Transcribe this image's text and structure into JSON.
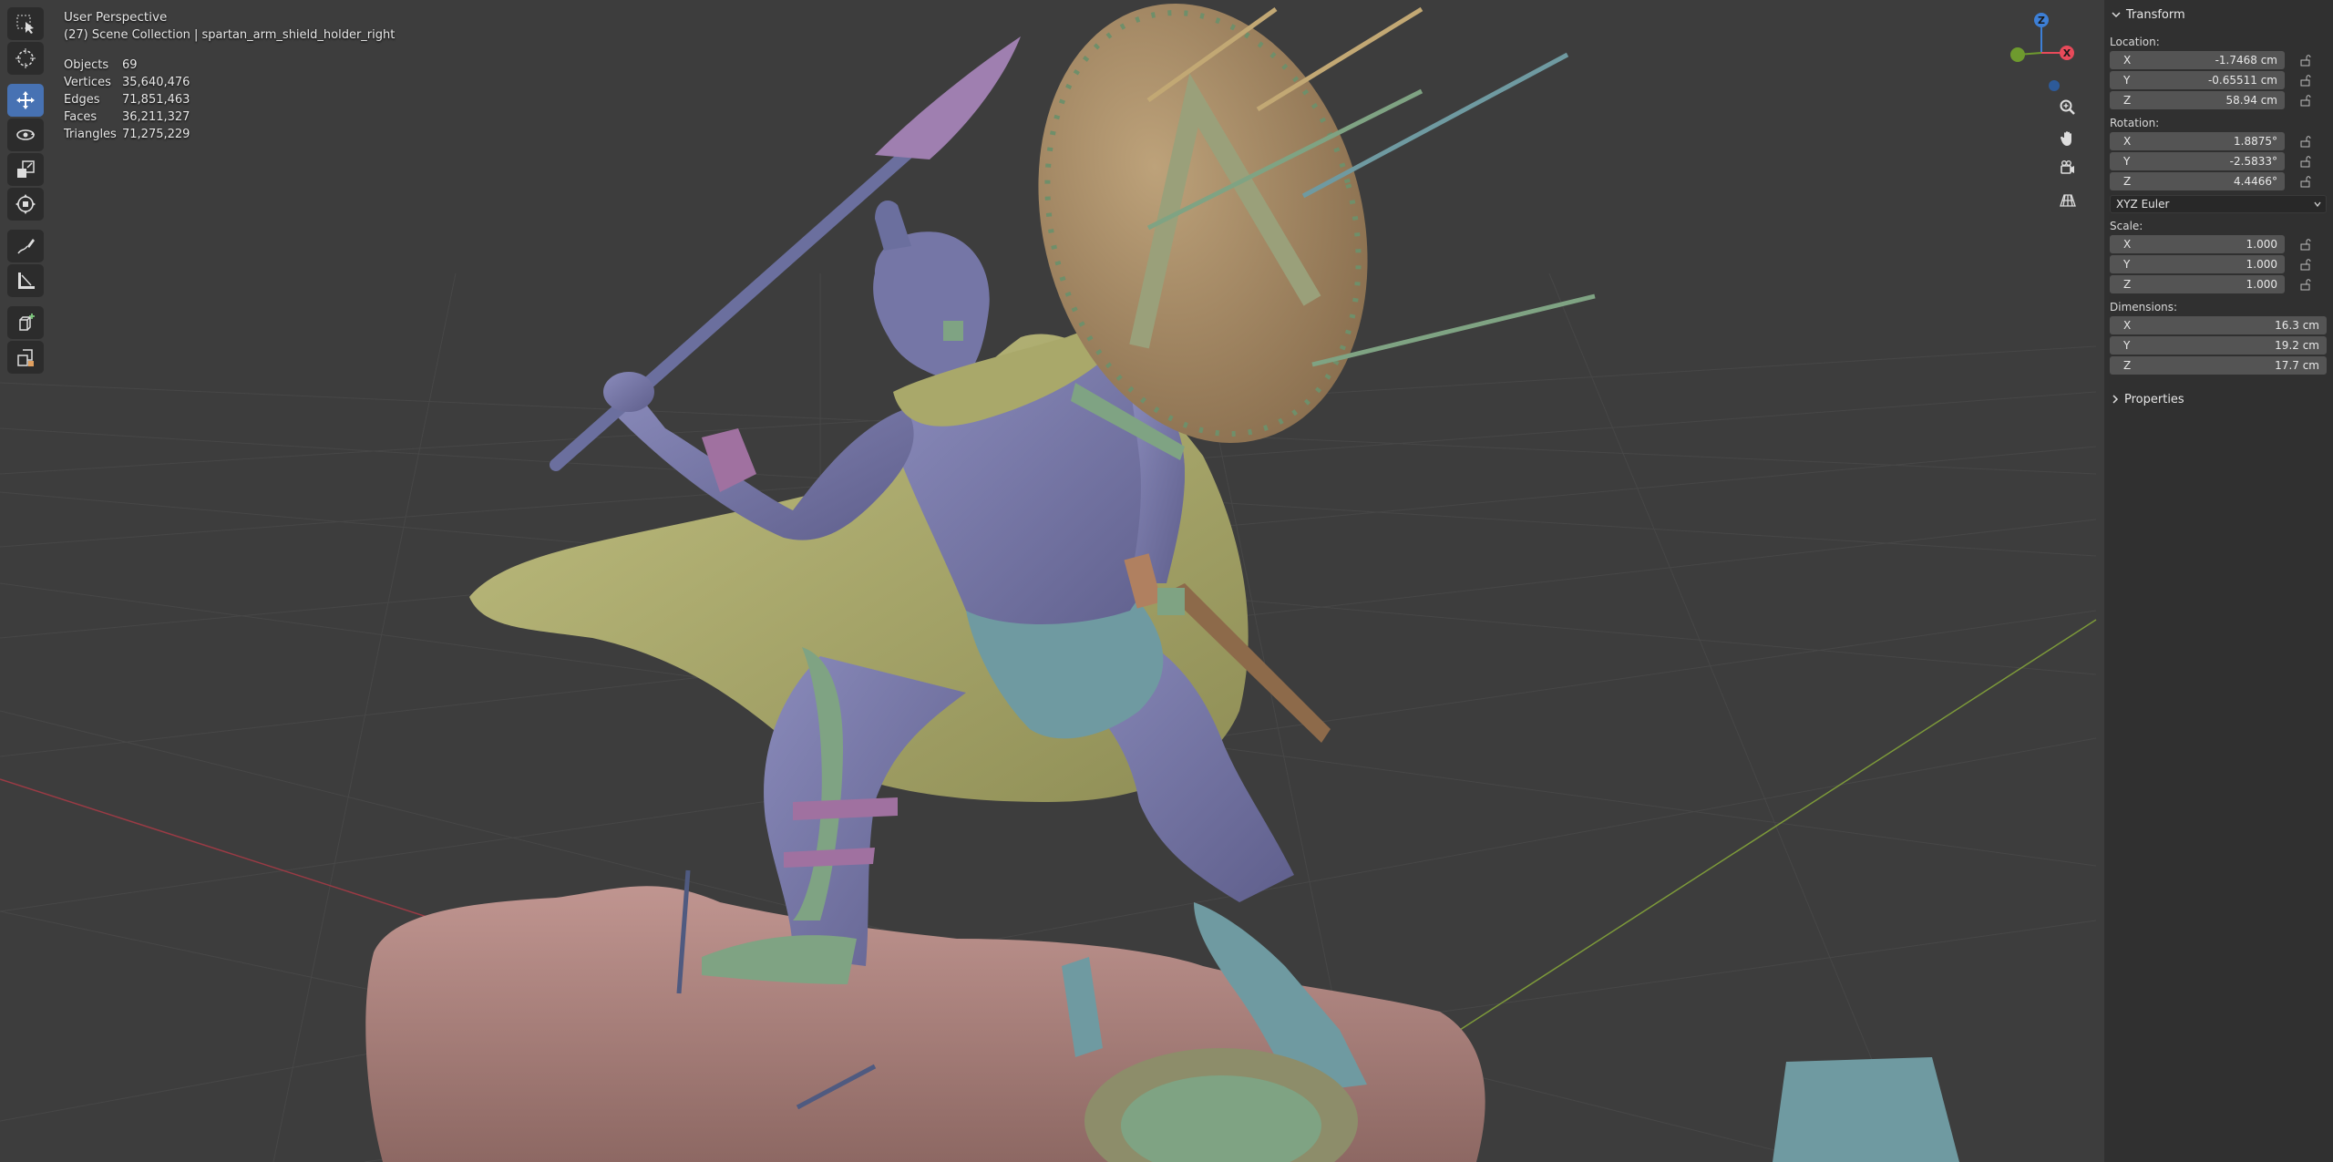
{
  "viewport": {
    "view_name": "User Perspective",
    "collection": "(27) Scene Collection | spartan_arm_shield_holder_right",
    "stats": [
      {
        "label": "Objects",
        "value": "69"
      },
      {
        "label": "Vertices",
        "value": "35,640,476"
      },
      {
        "label": "Edges",
        "value": "71,851,463"
      },
      {
        "label": "Faces",
        "value": "36,211,327"
      },
      {
        "label": "Triangles",
        "value": "71,275,229"
      }
    ]
  },
  "toolbar": {
    "tools": [
      {
        "name": "select-box-tool",
        "icon": "select-box-icon",
        "active": false
      },
      {
        "name": "cursor-tool",
        "icon": "cursor-icon",
        "active": false
      },
      {
        "name": "move-tool",
        "icon": "move-icon",
        "active": true
      },
      {
        "name": "rotate-tool",
        "icon": "rotate-icon",
        "active": false
      },
      {
        "name": "scale-tool",
        "icon": "scale-icon",
        "active": false
      },
      {
        "name": "transform-tool",
        "icon": "transform-icon",
        "active": false
      },
      {
        "name": "annotate-tool",
        "icon": "annotate-icon",
        "active": false
      },
      {
        "name": "measure-tool",
        "icon": "measure-icon",
        "active": false
      },
      {
        "name": "add-cube-tool",
        "icon": "add-cube-icon",
        "active": false
      },
      {
        "name": "extrude-tool",
        "icon": "extrude-icon",
        "active": false
      }
    ]
  },
  "gizmo": {
    "axis_x": "X",
    "axis_y": "Y",
    "axis_z": "Z",
    "colors": {
      "x": "#e84a5a",
      "y": "#6e9a2e",
      "z": "#3d7fd6"
    },
    "buttons": [
      "zoom-icon",
      "hand-icon",
      "camera-icon",
      "grid-icon"
    ]
  },
  "sidebar": {
    "panel_title": "Transform",
    "location": {
      "label": "Location:",
      "x": {
        "axis": "X",
        "value": "-1.7468 cm"
      },
      "y": {
        "axis": "Y",
        "value": "-0.65511 cm"
      },
      "z": {
        "axis": "Z",
        "value": "58.94 cm"
      }
    },
    "rotation": {
      "label": "Rotation:",
      "x": {
        "axis": "X",
        "value": "1.8875°"
      },
      "y": {
        "axis": "Y",
        "value": "-2.5833°"
      },
      "z": {
        "axis": "Z",
        "value": "4.4466°"
      }
    },
    "rotation_mode": "XYZ Euler",
    "scale": {
      "label": "Scale:",
      "x": {
        "axis": "X",
        "value": "1.000"
      },
      "y": {
        "axis": "Y",
        "value": "1.000"
      },
      "z": {
        "axis": "Z",
        "value": "1.000"
      }
    },
    "dimensions": {
      "label": "Dimensions:",
      "x": {
        "axis": "X",
        "value": "16.3 cm"
      },
      "y": {
        "axis": "Y",
        "value": "19.2 cm"
      },
      "z": {
        "axis": "Z",
        "value": "17.7 cm"
      }
    },
    "properties_label": "Properties"
  },
  "colors": {
    "viewport_bg": "#3d3d3d",
    "grid_line": "#474747",
    "x_axis_line": "#9a3b45",
    "y_axis_line": "#7d9a3a",
    "rock": "#b08480",
    "body": "#7a7ba8",
    "cape": "#a9a86a",
    "shield": "#a88c68",
    "green_armor": "#7fa383",
    "pink_straps": "#a071a0",
    "teal_parts": "#6f9aa1",
    "spear": "#6b6f9e",
    "spear_tip": "#9f7fb0",
    "active_tool": "#4772b3"
  }
}
